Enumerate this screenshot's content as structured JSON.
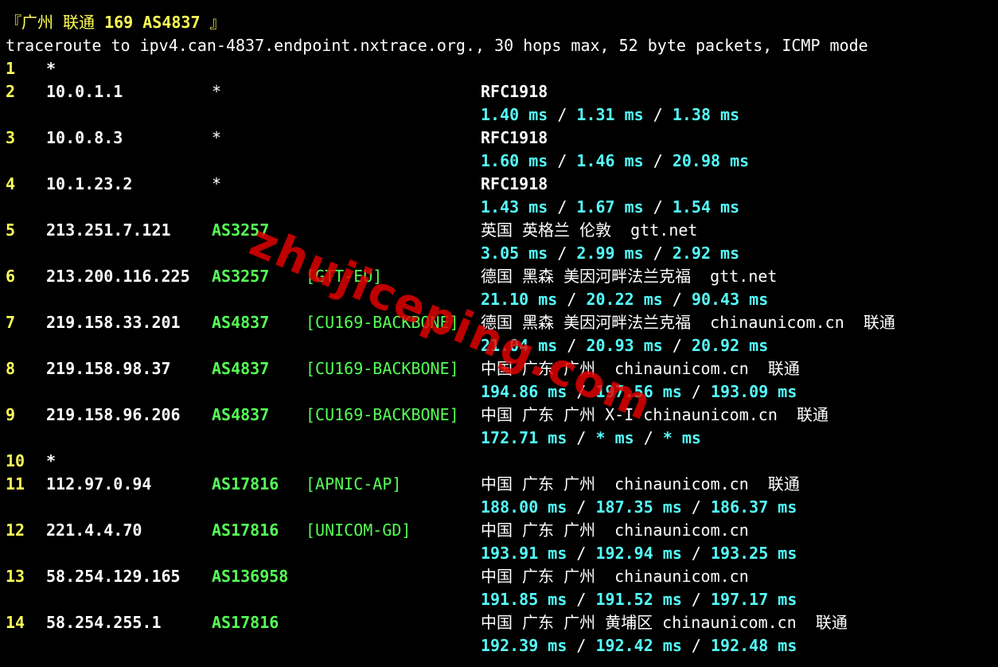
{
  "title": {
    "prefix": "『广州 联通 ",
    "bold": "169 AS4837",
    "suffix": " 』"
  },
  "command": "traceroute to ipv4.can-4837.endpoint.nxtrace.org., 30 hops max, 52 byte packets, ICMP mode",
  "hops": [
    {
      "n": "1",
      "ip": "*"
    },
    {
      "n": "2",
      "ip": "10.0.1.1",
      "asn": "*",
      "geo": "RFC1918",
      "rtt": [
        "1.40 ms",
        "1.31 ms",
        "1.38 ms"
      ]
    },
    {
      "n": "3",
      "ip": "10.0.8.3",
      "asn": "*",
      "geo": "RFC1918",
      "rtt": [
        "1.60 ms",
        "1.46 ms",
        "20.98 ms"
      ]
    },
    {
      "n": "4",
      "ip": "10.1.23.2",
      "asn": "*",
      "geo": "RFC1918",
      "rtt": [
        "1.43 ms",
        "1.67 ms",
        "1.54 ms"
      ]
    },
    {
      "n": "5",
      "ip": "213.251.7.121",
      "asn": "AS3257",
      "geo": "英国 英格兰 伦敦  gtt.net",
      "rtt": [
        "3.05 ms",
        "2.99 ms",
        "2.92 ms"
      ]
    },
    {
      "n": "6",
      "ip": "213.200.116.225",
      "asn": "AS3257",
      "tag": "[GTT-EU]",
      "geo": "德国 黑森 美因河畔法兰克福  gtt.net",
      "rtt": [
        "21.10 ms",
        "20.22 ms",
        "90.43 ms"
      ]
    },
    {
      "n": "7",
      "ip": "219.158.33.201",
      "asn": "AS4837",
      "tag": "[CU169-BACKBONE]",
      "geo": "德国 黑森 美因河畔法兰克福  chinaunicom.cn  联通",
      "rtt": [
        "21.04 ms",
        "20.93 ms",
        "20.92 ms"
      ]
    },
    {
      "n": "8",
      "ip": "219.158.98.37",
      "asn": "AS4837",
      "tag": "[CU169-BACKBONE]",
      "geo": "中国 广东 广州  chinaunicom.cn  联通",
      "rtt": [
        "194.86 ms",
        "197.56 ms",
        "193.09 ms"
      ]
    },
    {
      "n": "9",
      "ip": "219.158.96.206",
      "asn": "AS4837",
      "tag": "[CU169-BACKBONE]",
      "geo": "中国 广东 广州 X-I chinaunicom.cn  联通",
      "rtt": [
        "172.71 ms",
        "* ms",
        "* ms"
      ]
    },
    {
      "n": "10",
      "ip": "*"
    },
    {
      "n": "11",
      "ip": "112.97.0.94",
      "asn": "AS17816",
      "tag": "[APNIC-AP]",
      "geo": "中国 广东 广州  chinaunicom.cn  联通",
      "rtt": [
        "188.00 ms",
        "187.35 ms",
        "186.37 ms"
      ]
    },
    {
      "n": "12",
      "ip": "221.4.4.70",
      "asn": "AS17816",
      "tag": "[UNICOM-GD]",
      "geo": "中国 广东 广州  chinaunicom.cn",
      "rtt": [
        "193.91 ms",
        "192.94 ms",
        "193.25 ms"
      ]
    },
    {
      "n": "13",
      "ip": "58.254.129.165",
      "asn": "AS136958",
      "geo": "中国 广东 广州  chinaunicom.cn",
      "rtt": [
        "191.85 ms",
        "191.52 ms",
        "197.17 ms"
      ]
    },
    {
      "n": "14",
      "ip": "58.254.255.1",
      "asn": "AS17816",
      "geo": "中国 广东 广州 黄埔区 chinaunicom.cn  联通",
      "rtt": [
        "192.39 ms",
        "192.42 ms",
        "192.48 ms"
      ]
    }
  ],
  "rtt_separator": " / ",
  "watermark": "zhujiceping.com",
  "colors": {
    "background": "#000000",
    "hop_number": "#ffff55",
    "asn": "#55ff55",
    "rtt": "#55ffff",
    "watermark": "#e60000"
  }
}
